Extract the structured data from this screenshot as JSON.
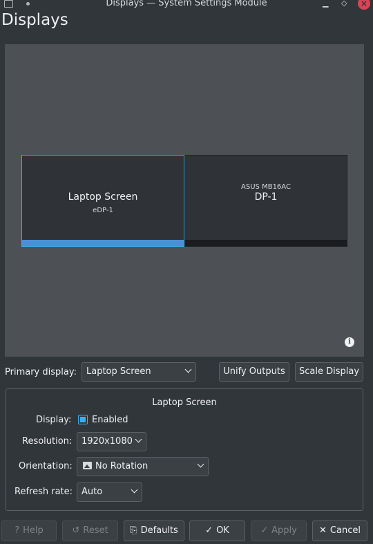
{
  "window": {
    "title": "Displays — System Settings Module",
    "min_glyph": "▁",
    "max_glyph": "◇",
    "close_glyph": "×"
  },
  "page_title": "Displays",
  "screens": [
    {
      "label": "Laptop Screen",
      "output": "eDP-1",
      "selected": true
    },
    {
      "model": "ASUS MB16AC",
      "output": "DP-1",
      "selected": false
    }
  ],
  "controls": {
    "primary_label": "Primary display:",
    "primary_value": "Laptop Screen",
    "unify_label": "Unify Outputs",
    "scale_label": "Scale Display"
  },
  "output_settings": {
    "title": "Laptop Screen",
    "display_label": "Display:",
    "enabled_label": "Enabled",
    "enabled": true,
    "resolution_label": "Resolution:",
    "resolution_value": "1920x1080",
    "orientation_label": "Orientation:",
    "orientation_value": "No Rotation",
    "refresh_label": "Refresh rate:",
    "refresh_value": "Auto"
  },
  "buttons": {
    "help": "Help",
    "reset": "Reset",
    "defaults": "Defaults",
    "ok": "OK",
    "apply": "Apply",
    "cancel": "Cancel"
  },
  "colors": {
    "accent": "#3daee9",
    "selected_bar": "#4a90d9",
    "close": "#da4453",
    "background": "#31363b",
    "canvas": "#4d5155"
  }
}
